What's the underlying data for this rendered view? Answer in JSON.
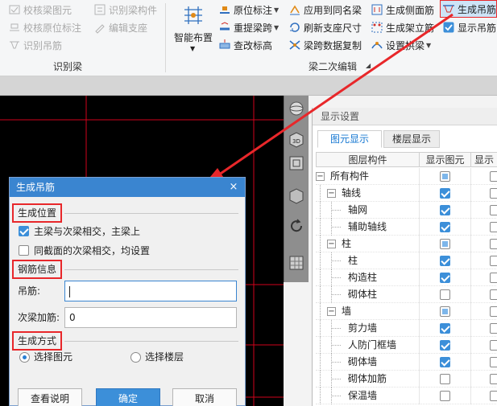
{
  "ribbon": {
    "groups": [
      {
        "label": "识别梁"
      },
      {
        "label": "梁二次编辑"
      }
    ],
    "recognize": {
      "items": [
        {
          "label": "校核梁图元",
          "icon": "check-beam-icon"
        },
        {
          "label": "识别梁构件",
          "icon": "recognize-component-icon"
        },
        {
          "label": "校核原位标注",
          "icon": "check-annotation-icon"
        },
        {
          "label": "编辑支座",
          "icon": "edit-support-icon"
        },
        {
          "label": "识别吊筋",
          "icon": "recognize-hanger-icon"
        }
      ]
    },
    "large_button": {
      "label": "智能布置",
      "icon": "smart-layout-icon"
    },
    "edit": {
      "items": [
        {
          "label": "原位标注",
          "icon": "in-situ-annotation-icon"
        },
        {
          "label": "重提梁跨",
          "icon": "reextract-span-icon"
        },
        {
          "label": "查改标高",
          "icon": "check-elevation-icon"
        },
        {
          "label": "应用到同名梁",
          "icon": "apply-same-name-icon"
        },
        {
          "label": "刷新支座尺寸",
          "icon": "refresh-support-icon"
        },
        {
          "label": "梁跨数据复制",
          "icon": "copy-span-data-icon"
        },
        {
          "label": "生成侧面筋",
          "icon": "side-rebar-icon"
        },
        {
          "label": "生成架立筋",
          "icon": "erection-rebar-icon"
        },
        {
          "label": "设置拱梁",
          "icon": "arch-beam-icon"
        },
        {
          "label": "生成吊筋",
          "icon": "hanger-rebar-icon"
        },
        {
          "label": "显示吊筋"
        }
      ]
    }
  },
  "view_tools": {
    "items": [
      {
        "icon": "orbit-icon"
      },
      {
        "icon": "3d-view-icon",
        "label": "3D"
      },
      {
        "icon": "plan-view-icon"
      },
      {
        "icon": "box-view-icon"
      },
      {
        "icon": "rotate-icon"
      },
      {
        "icon": "grid-view-icon"
      }
    ]
  },
  "display_panel": {
    "title": "显示设置",
    "tabs": [
      {
        "label": "图元显示",
        "active": true
      },
      {
        "label": "楼层显示",
        "active": false
      }
    ],
    "columns": [
      "图层构件",
      "显示图元",
      "显示"
    ],
    "rows": [
      {
        "label": "所有构件",
        "level": 0,
        "expand": "−",
        "show": "partial",
        "name_show": "off"
      },
      {
        "label": "轴线",
        "level": 1,
        "expand": "−",
        "show": "on",
        "name_show": "off"
      },
      {
        "label": "轴网",
        "level": 2,
        "show": "on",
        "name_show": "off"
      },
      {
        "label": "辅助轴线",
        "level": 2,
        "show": "on",
        "name_show": "off"
      },
      {
        "label": "柱",
        "level": 1,
        "expand": "−",
        "show": "partial",
        "name_show": "off"
      },
      {
        "label": "柱",
        "level": 2,
        "show": "on",
        "name_show": "off"
      },
      {
        "label": "构造柱",
        "level": 2,
        "show": "on",
        "name_show": "off"
      },
      {
        "label": "砌体柱",
        "level": 2,
        "show": "off",
        "name_show": "off"
      },
      {
        "label": "墙",
        "level": 1,
        "expand": "−",
        "show": "partial",
        "name_show": "off"
      },
      {
        "label": "剪力墙",
        "level": 2,
        "show": "on",
        "name_show": "off"
      },
      {
        "label": "人防门框墙",
        "level": 2,
        "show": "on",
        "name_show": "off"
      },
      {
        "label": "砌体墙",
        "level": 2,
        "show": "on",
        "name_show": "off"
      },
      {
        "label": "砌体加筋",
        "level": 2,
        "show": "off",
        "name_show": "off"
      },
      {
        "label": "保温墙",
        "level": 2,
        "show": "off",
        "name_show": "off"
      }
    ]
  },
  "dialog": {
    "title": "生成吊筋",
    "close_glyph": "×",
    "position_section": "生成位置",
    "opt_main_secondary": "主梁与次梁相交，主梁上",
    "opt_same_section": "同截面的次梁相交，均设置",
    "rebar_section": "钢筋信息",
    "hanger_label": "吊筋:",
    "hanger_value": "",
    "secondary_label": "次梁加筋:",
    "secondary_value": "0",
    "method_section": "生成方式",
    "radio_select_element": "选择图元",
    "radio_select_floor": "选择楼层",
    "btn_help": "查看说明",
    "btn_ok": "确定",
    "btn_cancel": "取消"
  },
  "colors": {
    "accent": "#3a85d0",
    "highlight_red": "#e8272a",
    "canvas_bg": "#000000",
    "grid_line": "#d0021b"
  }
}
